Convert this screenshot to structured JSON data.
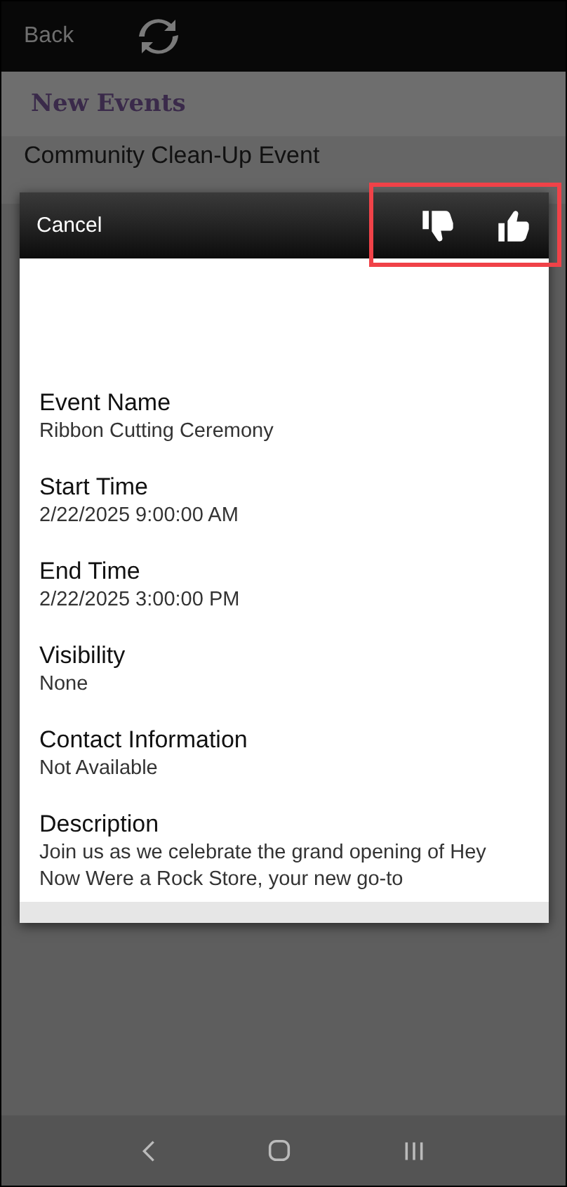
{
  "top_bar": {
    "back": "Back"
  },
  "section_title": "New Events",
  "list_item": {
    "title": "Community Clean-Up Event"
  },
  "dialog": {
    "cancel": "Cancel",
    "fields": [
      {
        "label": "Event Name",
        "value": "Ribbon Cutting Ceremony"
      },
      {
        "label": "Start Time",
        "value": "2/22/2025 9:00:00 AM"
      },
      {
        "label": "End Time",
        "value": "2/22/2025 3:00:00 PM"
      },
      {
        "label": "Visibility",
        "value": "None"
      },
      {
        "label": "Contact Information",
        "value": "Not Available"
      },
      {
        "label": "Description",
        "value": "Join us as we celebrate the grand opening of Hey Now Were a Rock Store, your new go-to"
      }
    ]
  }
}
